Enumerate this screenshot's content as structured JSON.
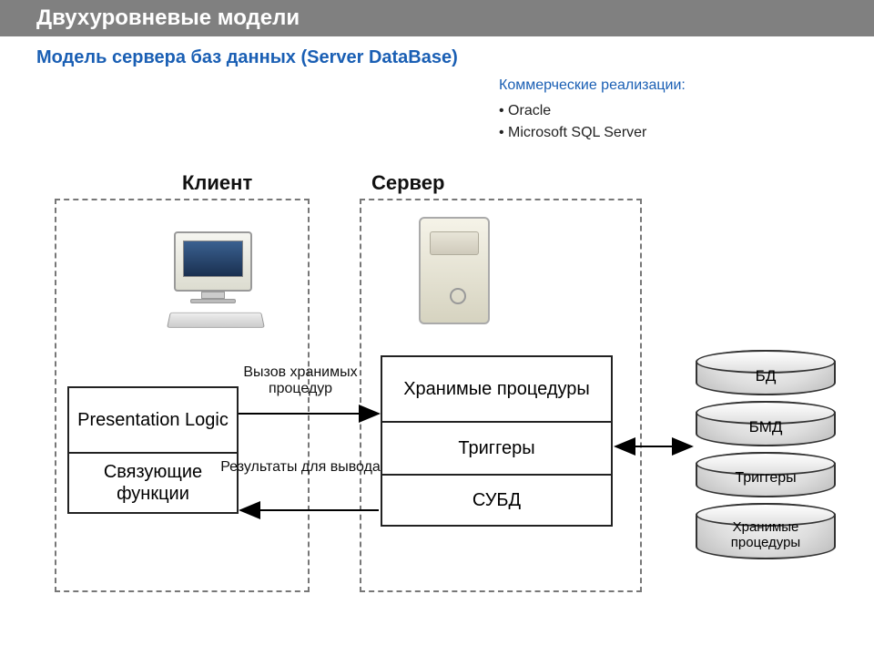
{
  "header": {
    "title": "Двухуровневые модели",
    "subtitle": "Модель сервера баз данных (Server DataBase)"
  },
  "implementations": {
    "heading": "Коммерческие реализации:",
    "items": [
      "Oracle",
      "Microsoft  SQL Server"
    ]
  },
  "diagram": {
    "client_label": "Клиент",
    "server_label": "Сервер",
    "client_boxes": {
      "presentation_logic": "Presentation Logic",
      "binding_functions": "Связующие функции"
    },
    "server_boxes": {
      "stored_procedures": "Хранимые процедуры",
      "triggers": "Триггеры",
      "dbms": "СУБД"
    },
    "db_cylinders": {
      "db": "БД",
      "bmd": "БМД",
      "triggers": "Триггеры",
      "stored_procedures": "Хранимые процедуры"
    },
    "arrows": {
      "call_sp": "Вызов хранимых процедур",
      "results": "Результаты для вывода"
    }
  }
}
